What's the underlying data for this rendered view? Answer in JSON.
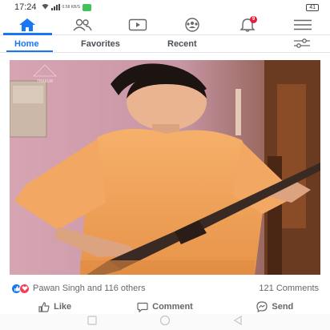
{
  "status_bar": {
    "time": "17:24",
    "net_speed": "0.58 KB/S",
    "battery": "41"
  },
  "top_nav": {
    "tabs": [
      {
        "icon": "home-icon",
        "active": true
      },
      {
        "icon": "friends-icon",
        "active": false
      },
      {
        "icon": "watch-icon",
        "active": false
      },
      {
        "icon": "groups-icon",
        "active": false
      },
      {
        "icon": "notifications-icon",
        "active": false,
        "badge": "9"
      },
      {
        "icon": "menu-icon",
        "active": false
      }
    ]
  },
  "feed_tabs": {
    "home": "Home",
    "favorites": "Favorites",
    "recent": "Recent",
    "active": "Home"
  },
  "post": {
    "photo_watermark": "THAKUR",
    "reactions_text": "Pawan Singh and 116 others",
    "comments_text": "121 Comments",
    "reaction_icons": [
      "like-icon",
      "love-icon"
    ]
  },
  "actions": {
    "like": "Like",
    "comment": "Comment",
    "send": "Send"
  },
  "colors": {
    "accent": "#1877f2",
    "love": "#f33e58",
    "badge": "#e41e3f",
    "text_muted": "#65676b"
  }
}
